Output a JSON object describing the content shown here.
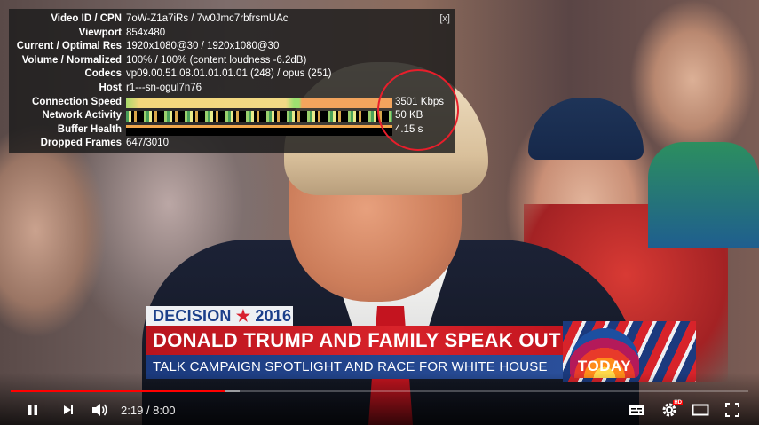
{
  "stats": {
    "close_label": "[x]",
    "rows": [
      {
        "key": "Video ID / CPN",
        "value": "7oW-Z1a7iRs / 7w0Jmc7rbfrsmUAc"
      },
      {
        "key": "Viewport",
        "value": "854x480"
      },
      {
        "key": "Current / Optimal Res",
        "value": "1920x1080@30 / 1920x1080@30"
      },
      {
        "key": "Volume / Normalized",
        "value": "100% / 100% (content loudness -6.2dB)"
      },
      {
        "key": "Codecs",
        "value": "vp09.00.51.08.01.01.01.01 (248) / opus (251)"
      },
      {
        "key": "Host",
        "value": "r1---sn-ogul7n76"
      },
      {
        "key": "Connection Speed",
        "value": "3501 Kbps"
      },
      {
        "key": "Network Activity",
        "value": "50 KB"
      },
      {
        "key": "Buffer Health",
        "value": "4.15 s"
      },
      {
        "key": "Dropped Frames",
        "value": "647/3010"
      }
    ]
  },
  "lower_third": {
    "tag_prefix": "DECISION",
    "tag_star": "★",
    "tag_year": "2016",
    "headline": "DONALD TRUMP AND FAMILY SPEAK OUT",
    "subheadline": "TALK CAMPAIGN SPOTLIGHT AND RACE FOR WHITE HOUSE",
    "logo_text": "TODAY"
  },
  "player": {
    "current_time": "2:19",
    "duration": "8:00",
    "time_display": "2:19 / 8:00",
    "played_fraction": 0.29,
    "loaded_fraction": 0.31,
    "hd_badge": "HD",
    "icons": [
      "pause-icon",
      "next-icon",
      "volume-icon",
      "subtitles-icon",
      "settings-icon",
      "theater-mode-icon",
      "fullscreen-icon"
    ]
  },
  "colors": {
    "progress_played": "#ff0000",
    "annotation_circle": "#e81e2b",
    "headline_red": "#d8232a",
    "subheadline_blue": "#1b3a7e"
  }
}
